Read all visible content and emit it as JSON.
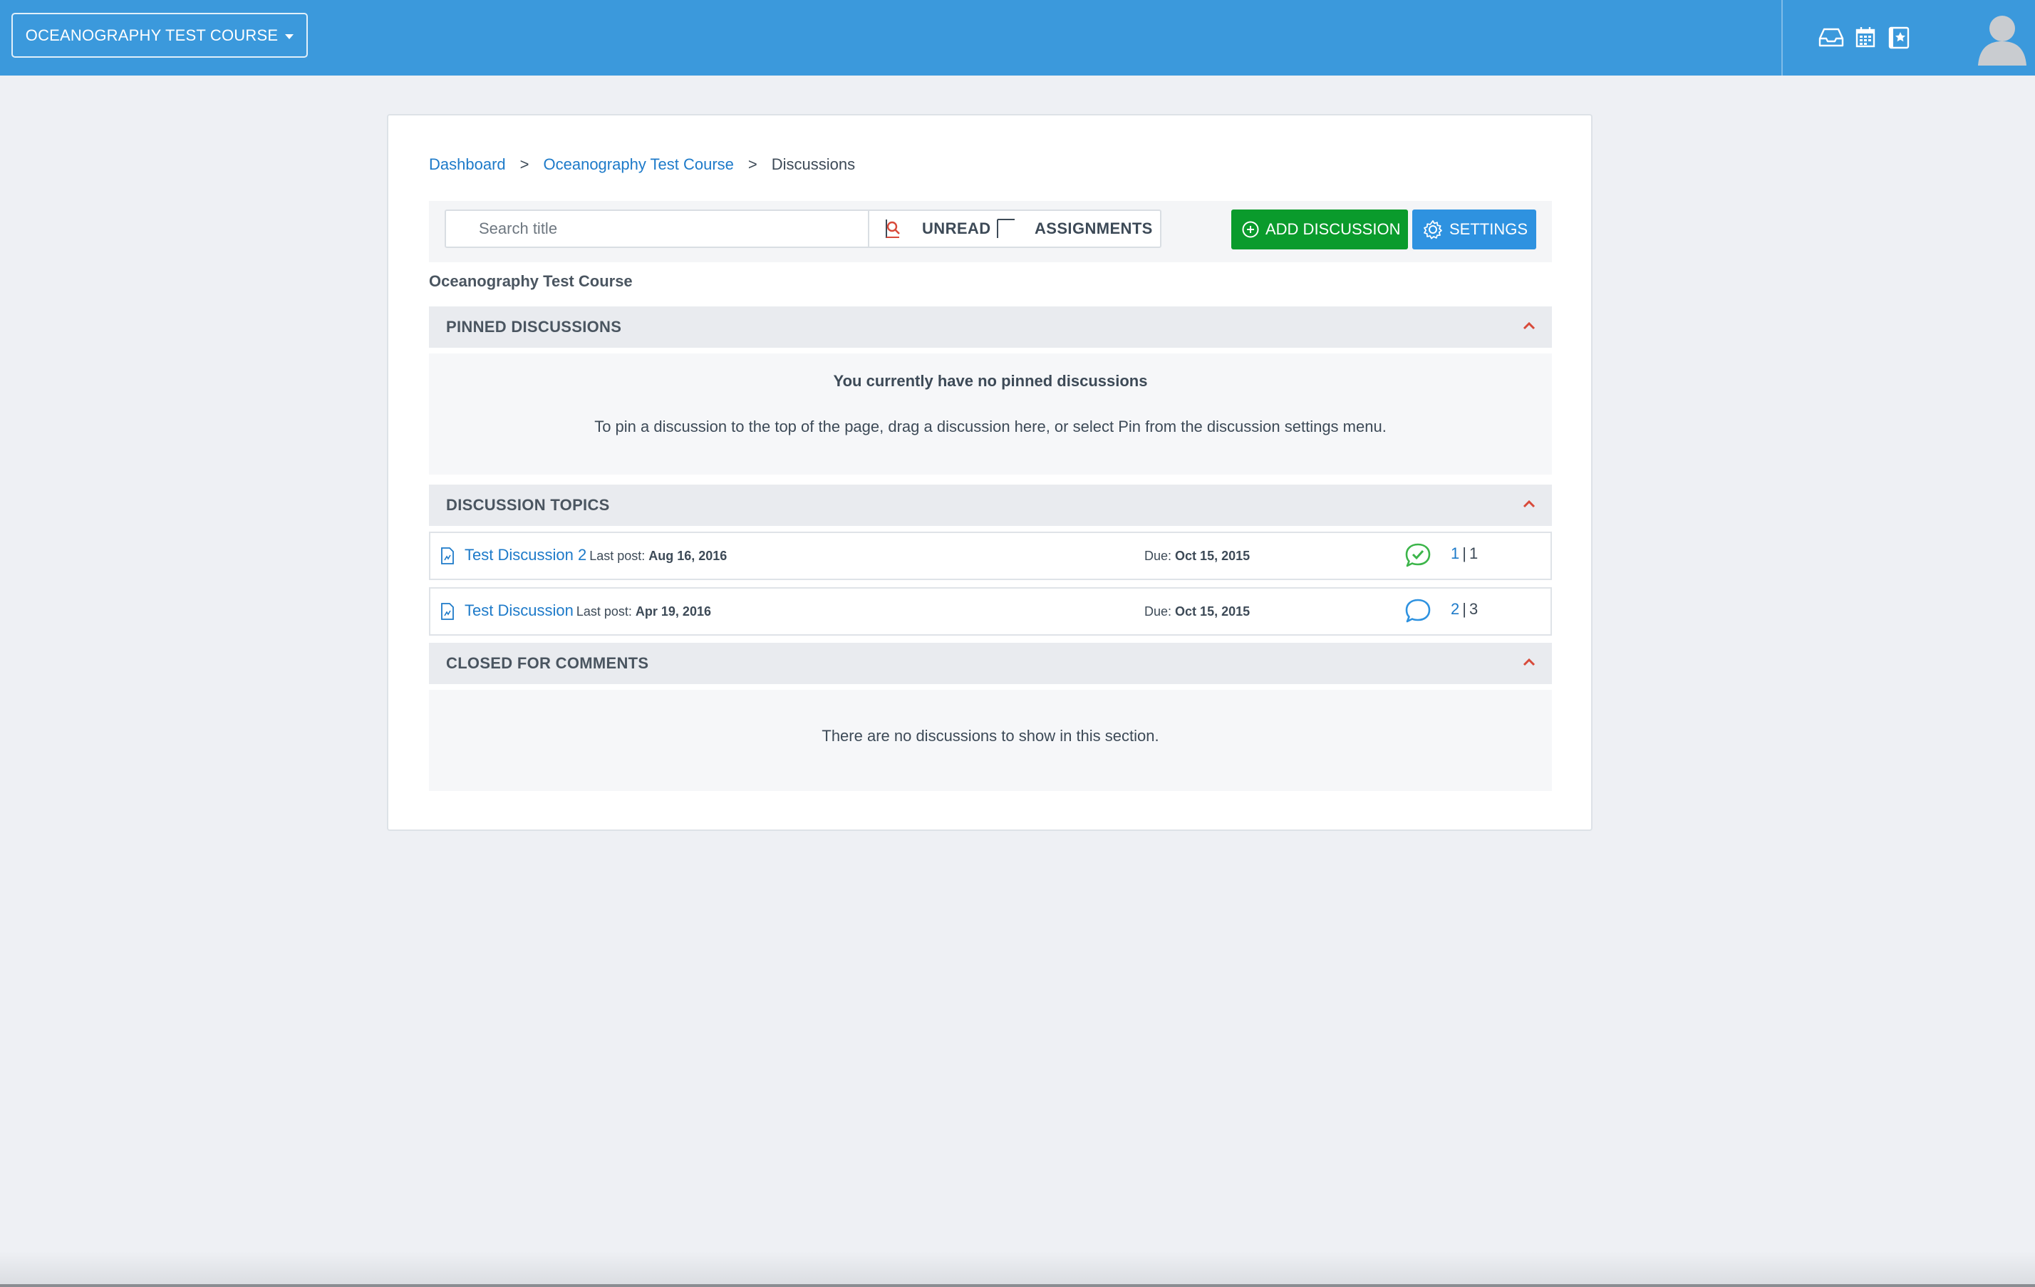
{
  "header": {
    "course_menu_label": "OCEANOGRAPHY TEST COURSE",
    "icons": [
      "inbox-icon",
      "calendar-icon",
      "grades-icon"
    ],
    "accent_color": "#3b99dc"
  },
  "breadcrumb": {
    "items": [
      "Dashboard",
      "Oceanography Test Course",
      "Discussions"
    ],
    "separator": ">"
  },
  "toolbar": {
    "search_placeholder": "Search title",
    "unread_label": "UNREAD",
    "assignments_label": "ASSIGNMENTS",
    "add_discussion_label": "ADD DISCUSSION",
    "settings_label": "SETTINGS",
    "add_color": "#0a9b2c",
    "settings_color": "#2e92e0"
  },
  "course_heading": "Oceanography Test Course",
  "sections": {
    "pinned": {
      "title": "PINNED DISCUSSIONS",
      "empty_title": "You currently have no pinned discussions",
      "empty_hint": "To pin a discussion to the top of the page, drag a discussion here, or select Pin from the discussion settings menu."
    },
    "topics": {
      "title": "DISCUSSION TOPICS",
      "rows": [
        {
          "title": "Test Discussion 2",
          "last_post_label": "Last post:",
          "last_post_date": "Aug 16, 2016",
          "due_label": "Due:",
          "due_date": "Oct 15, 2015",
          "reply_icon": "replied-check-icon",
          "unread_count": "1",
          "separator": "|",
          "total_count": "1"
        },
        {
          "title": "Test Discussion",
          "last_post_label": "Last post:",
          "last_post_date": "Apr 19, 2016",
          "due_label": "Due:",
          "due_date": "Oct 15, 2015",
          "reply_icon": "comment-bubble-icon",
          "unread_count": "2",
          "separator": "|",
          "total_count": "3"
        }
      ]
    },
    "closed": {
      "title": "CLOSED FOR COMMENTS",
      "empty_text": "There are no discussions to show in this section."
    }
  }
}
